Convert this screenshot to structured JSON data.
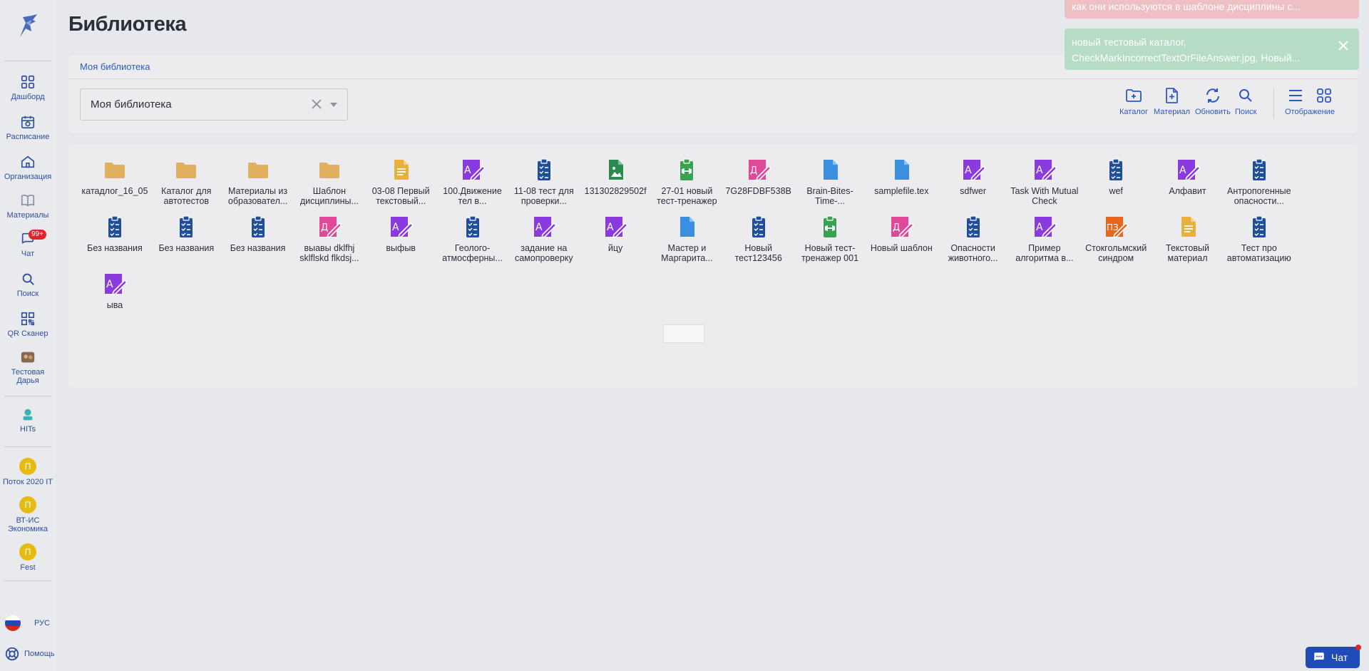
{
  "page_title": "Библиотека",
  "breadcrumb": "Моя библиотека",
  "library_select": {
    "value": "Моя библиотека"
  },
  "sidebar": {
    "items": [
      {
        "label": "Дашборд",
        "icon": "grid-icon"
      },
      {
        "label": "Расписание",
        "icon": "calendar-icon"
      },
      {
        "label": "Организация",
        "icon": "home-icon"
      },
      {
        "label": "Материалы",
        "icon": "book-icon"
      },
      {
        "label": "Чат",
        "icon": "chat-icon",
        "badge": "99+"
      },
      {
        "label": "Поиск",
        "icon": "search-icon"
      },
      {
        "label": "QR Сканер",
        "icon": "qr-icon"
      },
      {
        "label": "Тестовая Дарья",
        "icon": "avatar-icon"
      },
      {
        "label": "HITs",
        "icon": "hits-icon"
      }
    ],
    "groups": [
      {
        "letter": "П",
        "label": "Поток 2020 IT"
      },
      {
        "letter": "П",
        "label": "ВТ-ИС Экономика"
      },
      {
        "letter": "П",
        "label": "Fest"
      }
    ],
    "language": "РУС",
    "help": "Помощь"
  },
  "toolbar": {
    "catalog": "Каталог",
    "material": "Материал",
    "refresh": "Обновить",
    "search": "Поиск",
    "view": "Отображение"
  },
  "toasts": [
    {
      "text": "как они используются в шаблоне дисциплины с..."
    },
    {
      "text": "новый тестовый каталог, CheckMarkIncorrectTextOrFileAnswer.jpg, Новый..."
    }
  ],
  "chat_button": "Чат",
  "colors": {
    "folder": "#e0b05e",
    "text_doc": "#e6b23b",
    "assignment": "#8a3be0",
    "test": "#1f4f94",
    "image": "#2b8a4e",
    "trainer": "#3aa052",
    "template": "#e0489a",
    "file": "#3a8fe0",
    "pz": "#e8671c",
    "accent": "#2d57c7"
  },
  "items": [
    {
      "label": "катадлог_16_05",
      "type": "folder"
    },
    {
      "label": "Каталог для автотестов",
      "type": "folder"
    },
    {
      "label": "Материалы из образовател...",
      "type": "folder"
    },
    {
      "label": "Шаблон дисциплины...",
      "type": "folder"
    },
    {
      "label": "03-08 Первый текстовый...",
      "type": "text_doc"
    },
    {
      "label": "100.Движение тел в...",
      "type": "assignment"
    },
    {
      "label": "11-08 тест для проверки...",
      "type": "test"
    },
    {
      "label": "131302829502f",
      "type": "image"
    },
    {
      "label": "27-01 новый тест-тренажер",
      "type": "trainer"
    },
    {
      "label": "7G28FDBF538B",
      "type": "template"
    },
    {
      "label": "Brain-Bites-Time-...",
      "type": "file"
    },
    {
      "label": "samplefile.tex",
      "type": "file"
    },
    {
      "label": "sdfwer",
      "type": "assignment"
    },
    {
      "label": "Task With Mutual Check",
      "type": "assignment"
    },
    {
      "label": "wef",
      "type": "test"
    },
    {
      "label": "Алфавит",
      "type": "assignment"
    },
    {
      "label": "Антропогенные опасности...",
      "type": "test"
    },
    {
      "label": "Без названия",
      "type": "test"
    },
    {
      "label": "Без названия",
      "type": "test"
    },
    {
      "label": "Без названия",
      "type": "test"
    },
    {
      "label": "выавы dklfhj sklflskd flkdsj...",
      "type": "template"
    },
    {
      "label": "выфыв",
      "type": "assignment"
    },
    {
      "label": "Геолого-атмосферны...",
      "type": "test"
    },
    {
      "label": "задание на самопроверку",
      "type": "assignment"
    },
    {
      "label": "йцу",
      "type": "assignment"
    },
    {
      "label": "Мастер и Маргарита...",
      "type": "file"
    },
    {
      "label": "Новый тест123456",
      "type": "test"
    },
    {
      "label": "Новый тест-тренажер 001",
      "type": "trainer"
    },
    {
      "label": "Новый шаблон",
      "type": "template"
    },
    {
      "label": "Опасности животного...",
      "type": "test"
    },
    {
      "label": "Пример алгоритма в...",
      "type": "assignment"
    },
    {
      "label": "Стокгольмский синдром",
      "type": "pz"
    },
    {
      "label": "Текстовый материал",
      "type": "text_doc"
    },
    {
      "label": "Тест про автоматизацию",
      "type": "test"
    },
    {
      "label": "ыва",
      "type": "assignment"
    }
  ]
}
